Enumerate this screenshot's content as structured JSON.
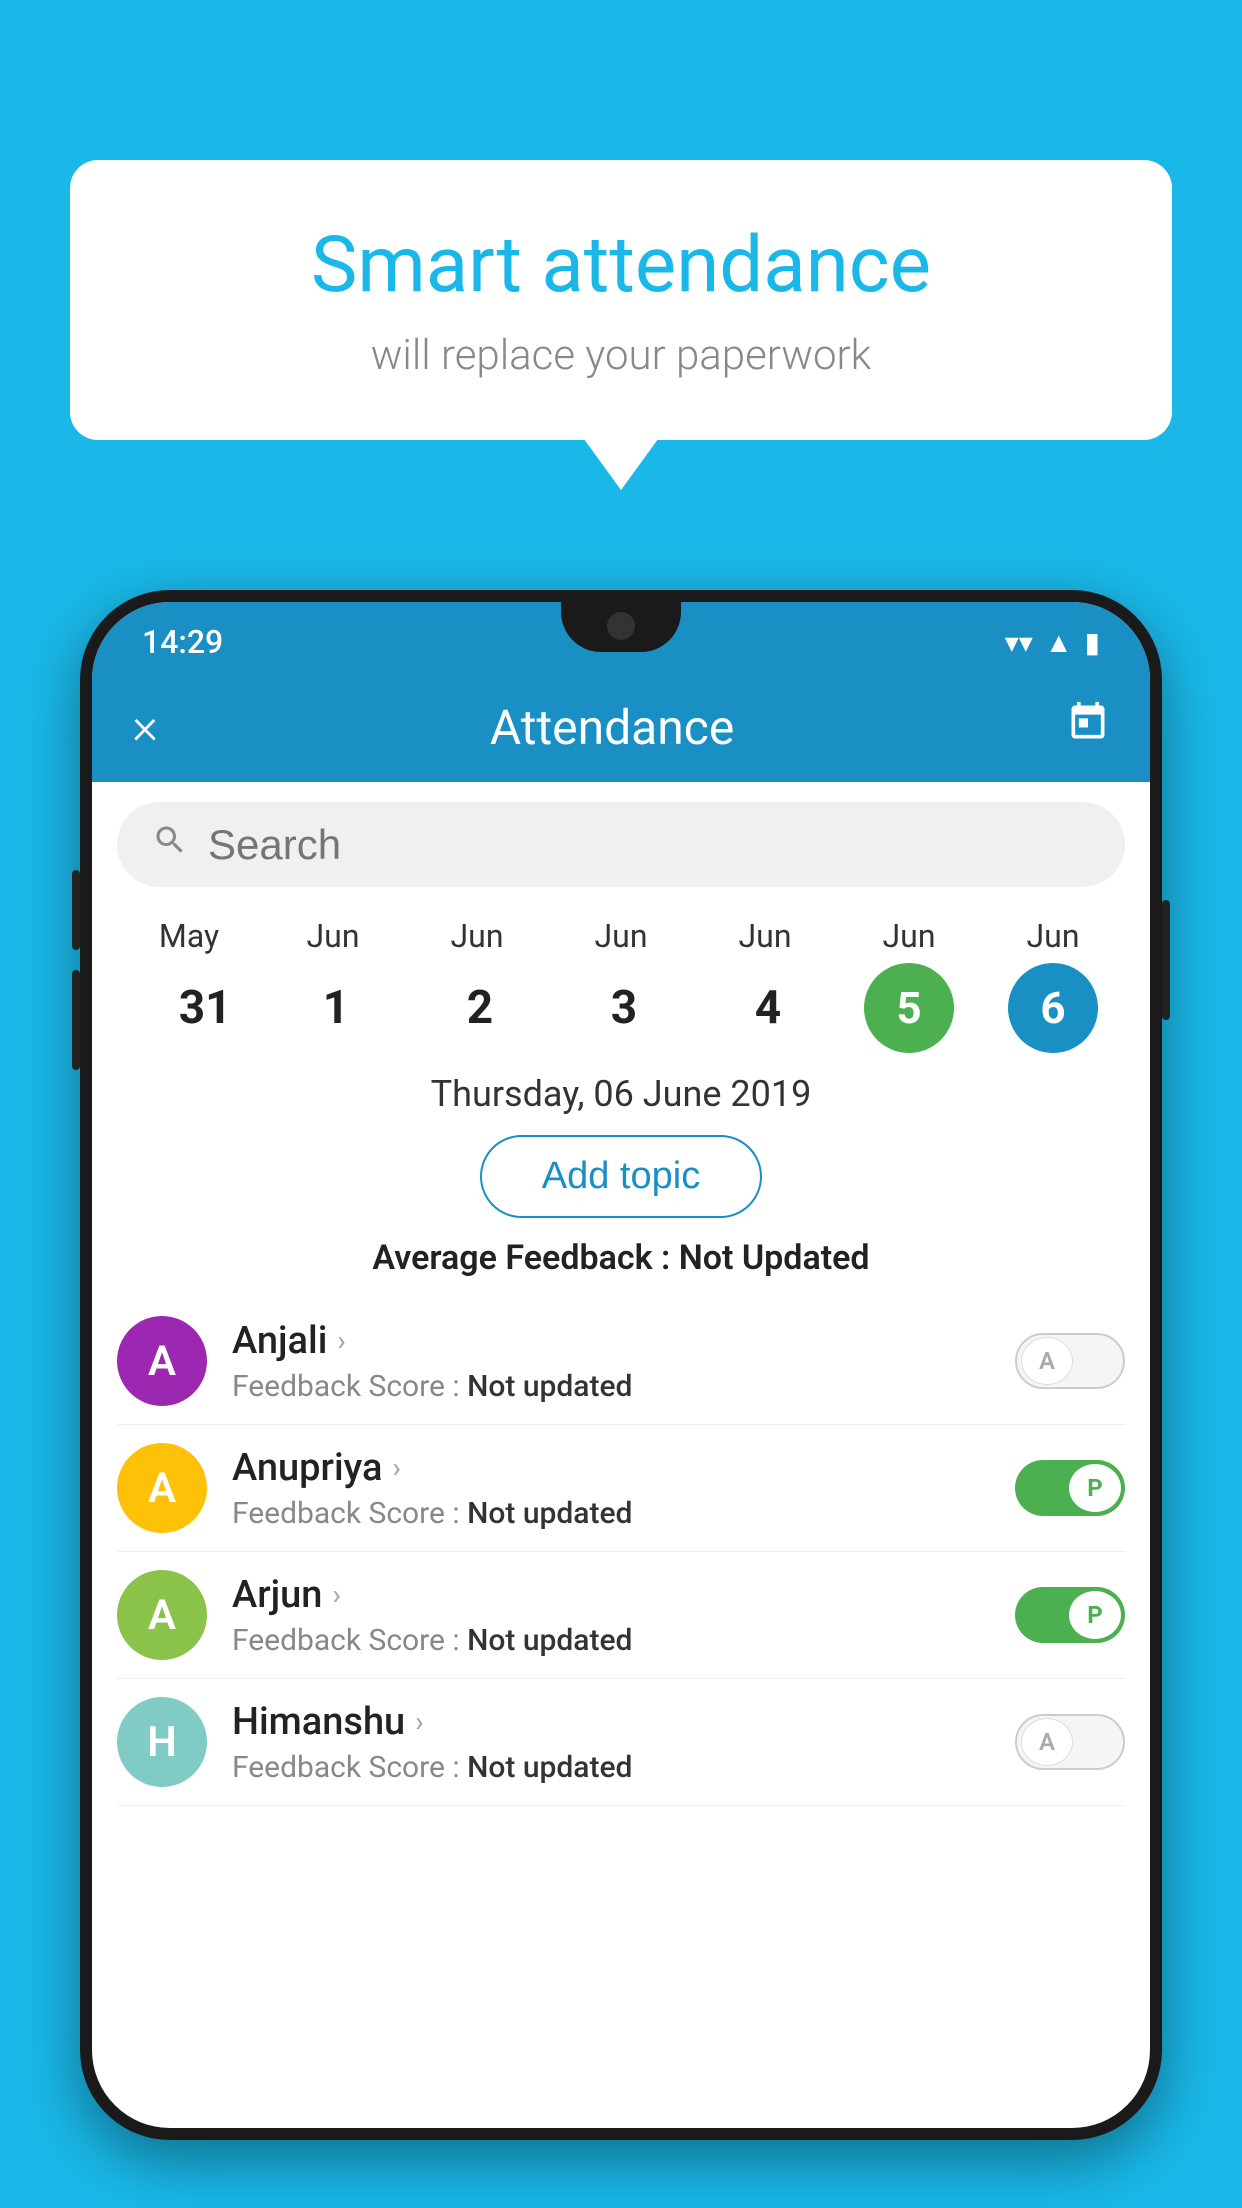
{
  "background_color": "#1ab8e8",
  "speech_bubble": {
    "title": "Smart attendance",
    "subtitle": "will replace your paperwork"
  },
  "phone": {
    "status_bar": {
      "time": "14:29",
      "icons": [
        "wifi",
        "signal",
        "battery"
      ]
    },
    "header": {
      "title": "Attendance",
      "close_label": "×",
      "calendar_icon": "📅"
    },
    "search": {
      "placeholder": "Search"
    },
    "calendar": {
      "columns": [
        {
          "month": "May",
          "date": "31"
        },
        {
          "month": "Jun",
          "date": "1"
        },
        {
          "month": "Jun",
          "date": "2"
        },
        {
          "month": "Jun",
          "date": "3"
        },
        {
          "month": "Jun",
          "date": "4"
        },
        {
          "month": "Jun",
          "date": "5",
          "style": "green"
        },
        {
          "month": "Jun",
          "date": "6",
          "style": "blue"
        }
      ]
    },
    "selected_date": "Thursday, 06 June 2019",
    "add_topic_label": "Add topic",
    "avg_feedback_label": "Average Feedback :",
    "avg_feedback_value": "Not Updated",
    "students": [
      {
        "name": "Anjali",
        "avatar_letter": "A",
        "avatar_color": "purple",
        "feedback_label": "Feedback Score :",
        "feedback_value": "Not updated",
        "attendance": "absent",
        "toggle_letter": "A"
      },
      {
        "name": "Anupriya",
        "avatar_letter": "A",
        "avatar_color": "yellow",
        "feedback_label": "Feedback Score :",
        "feedback_value": "Not updated",
        "attendance": "present",
        "toggle_letter": "P"
      },
      {
        "name": "Arjun",
        "avatar_letter": "A",
        "avatar_color": "green",
        "feedback_label": "Feedback Score :",
        "feedback_value": "Not updated",
        "attendance": "present",
        "toggle_letter": "P"
      },
      {
        "name": "Himanshu",
        "avatar_letter": "H",
        "avatar_color": "teal",
        "feedback_label": "Feedback Score :",
        "feedback_value": "Not updated",
        "attendance": "absent",
        "toggle_letter": "A"
      }
    ]
  }
}
